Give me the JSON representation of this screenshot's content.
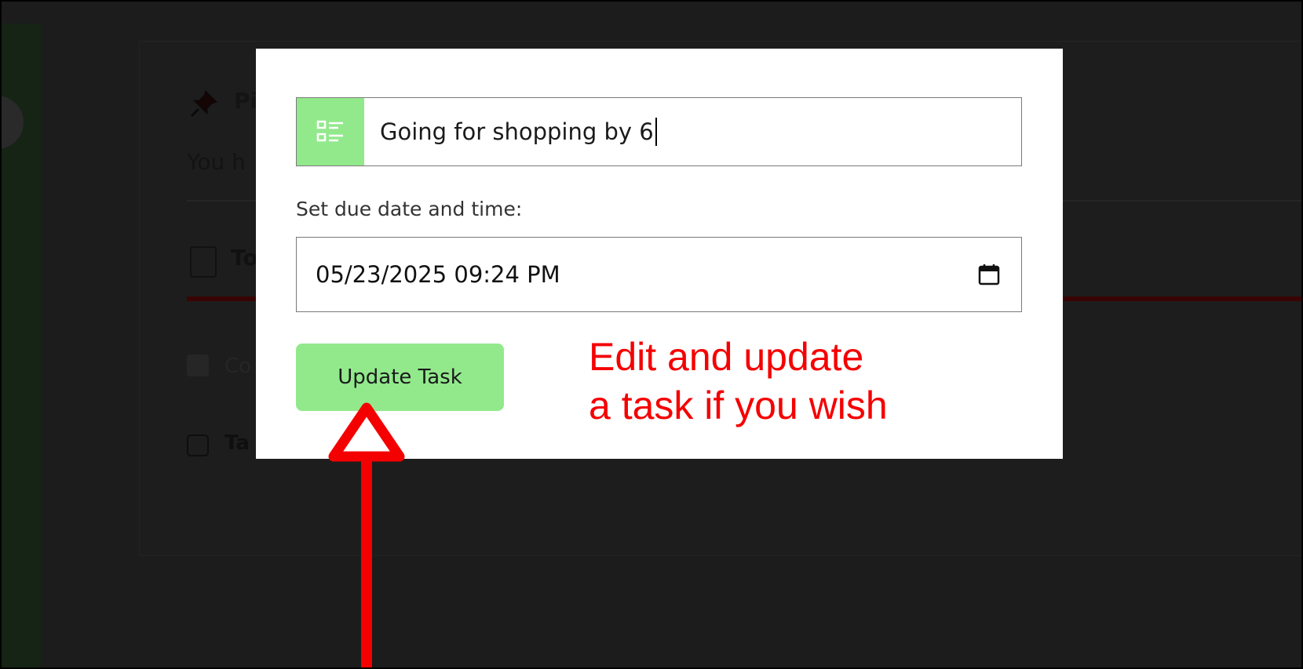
{
  "background": {
    "title": "Pi",
    "subtitle": "You h",
    "section_title": "To",
    "completed_label": "Co",
    "task_label": "Ta"
  },
  "modal": {
    "task_value": "Going for shopping by 6",
    "due_label": "Set due date and time:",
    "due_value": "05/23/2025 09:24 PM",
    "update_button": "Update Task"
  },
  "annotation": {
    "line1": "Edit and update",
    "line2": "a task if you wish"
  },
  "colors": {
    "accent_green": "#92e98c",
    "annotation_red": "#f50000",
    "overlay": "#1c1c1c"
  },
  "icons": {
    "task_icon": "list-icon",
    "date_icon": "calendar-icon",
    "pin_icon": "pushpin-icon",
    "note_icon": "note-icon"
  }
}
